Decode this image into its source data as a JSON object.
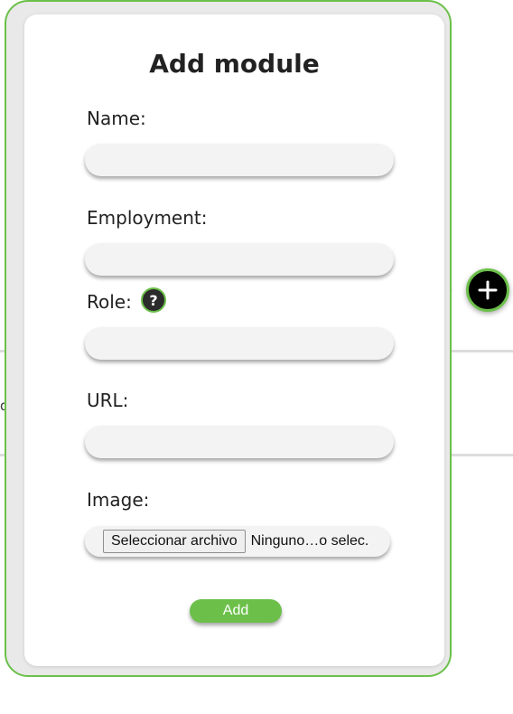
{
  "modal": {
    "title": "Add module",
    "fields": {
      "name": {
        "label": "Name:",
        "value": ""
      },
      "employment": {
        "label": "Employment:",
        "value": ""
      },
      "role": {
        "label": "Role:",
        "value": "",
        "help_glyph": "?"
      },
      "url": {
        "label": "URL:",
        "value": ""
      },
      "image": {
        "label": "Image:",
        "button_label": "Seleccionar archivo",
        "status": "Ninguno…o selec."
      }
    },
    "submit_label": "Add"
  },
  "background": {
    "partial_glyph": "d"
  },
  "fab_icon": "plus-icon",
  "colors": {
    "accent": "#6cc04a",
    "fab": "#000000",
    "help_bg": "#2b2b2b"
  }
}
